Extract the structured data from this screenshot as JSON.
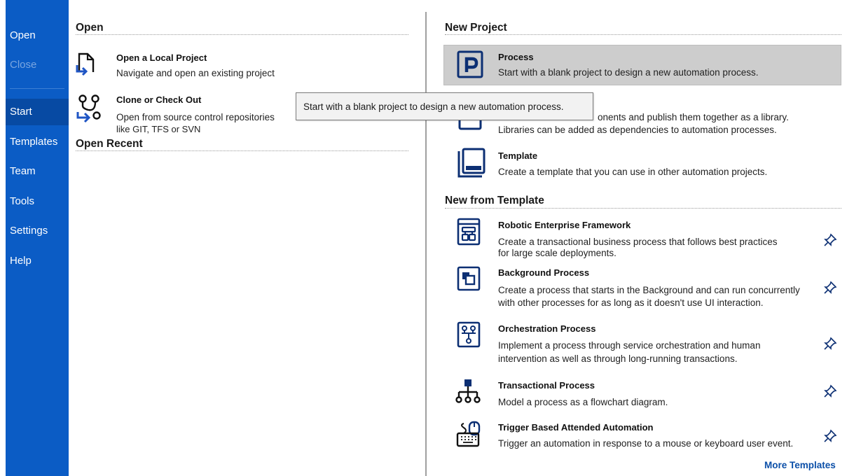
{
  "sidebar": {
    "items": [
      {
        "label": "Open"
      },
      {
        "label": "Close"
      },
      {
        "label": "Start"
      },
      {
        "label": "Templates"
      },
      {
        "label": "Team"
      },
      {
        "label": "Tools"
      },
      {
        "label": "Settings"
      },
      {
        "label": "Help"
      }
    ],
    "active": "Start",
    "colors": {
      "background": "#0b5cc5",
      "active": "#074aa3"
    }
  },
  "open_section": {
    "title": "Open",
    "items": [
      {
        "title": "Open a Local Project",
        "desc": "Navigate and open an existing project",
        "icon": "open-folder-icon"
      },
      {
        "title": "Clone or Check Out",
        "desc_line1": "Open from source control repositories",
        "desc_line2": "like GIT, TFS or SVN",
        "icon": "git-branch-icon"
      }
    ]
  },
  "open_recent": {
    "title": "Open Recent"
  },
  "new_project": {
    "title": "New Project",
    "items": [
      {
        "title": "Process",
        "desc": "Start with a blank project to design a new automation process.",
        "icon": "process-p-icon",
        "selected": true
      },
      {
        "title": "",
        "desc_line1": "onents and publish them together as a library.",
        "desc_line2": "Libraries can be added as dependencies to automation processes.",
        "icon": "library-icon"
      },
      {
        "title": "Template",
        "desc": "Create a template that you can use in other automation projects.",
        "icon": "template-icon"
      }
    ]
  },
  "new_from_template": {
    "title": "New from Template",
    "items": [
      {
        "title": "Robotic Enterprise Framework",
        "desc_line1": "Create a transactional business process that follows best practices",
        "desc_line2": "for large scale deployments.",
        "icon": "framework-icon"
      },
      {
        "title": "Background Process",
        "desc_line1": "Create a process that starts in the Background and can run concurrently",
        "desc_line2": "with other processes for as long as it doesn't use UI interaction.",
        "icon": "background-process-icon"
      },
      {
        "title": "Orchestration Process",
        "desc_line1": "Implement a process through service orchestration and human",
        "desc_line2": "intervention as well as through long-running transactions.",
        "icon": "orchestration-icon"
      },
      {
        "title": "Transactional Process",
        "desc": "Model a process as a flowchart diagram.",
        "icon": "flowchart-icon"
      },
      {
        "title": "Trigger Based Attended Automation",
        "desc": "Trigger an automation in response to a mouse or keyboard user event.",
        "icon": "keyboard-mouse-icon"
      }
    ],
    "more_link": "More Templates"
  },
  "tooltip": {
    "text": "Start with a blank project to design a new automation process."
  },
  "colors": {
    "accent": "#0b5cc5",
    "icon": "#0c2f73",
    "selected_bg": "#cdcdcd"
  }
}
